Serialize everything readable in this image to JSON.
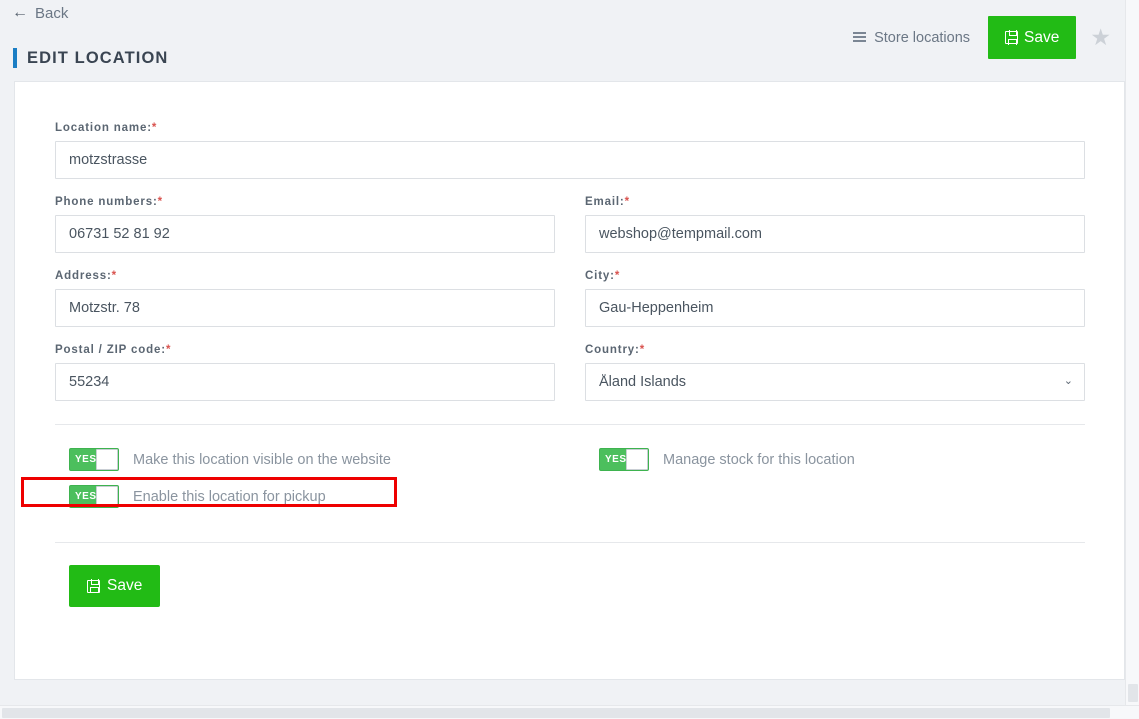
{
  "header": {
    "back_label": "Back",
    "page_title": "EDIT LOCATION",
    "store_locations_label": "Store locations",
    "save_label": "Save",
    "star_glyph": "★",
    "accent_color": "#1b7ec4",
    "save_color": "#22bb15"
  },
  "form": {
    "fields": {
      "location_name": {
        "label": "Location name:",
        "required": "*",
        "value": "motzstrasse",
        "placeholder": ""
      },
      "phone_numbers": {
        "label": "Phone numbers:",
        "required": "*",
        "value": "06731 52 81 92",
        "placeholder": ""
      },
      "email": {
        "label": "Email:",
        "required": "*",
        "value": "webshop@tempmail.com",
        "placeholder": ""
      },
      "address": {
        "label": "Address:",
        "required": "*",
        "value": "Motzstr. 78",
        "placeholder": ""
      },
      "city": {
        "label": "City:",
        "required": "*",
        "value": "Gau-Heppenheim",
        "placeholder": ""
      },
      "postal_code": {
        "label": "Postal / ZIP code:",
        "required": "*",
        "value": "55234",
        "placeholder": ""
      },
      "country": {
        "label": "Country:",
        "required": "*",
        "value": "Åland Islands",
        "caret_glyph": "⌄",
        "options": [
          "Åland Islands"
        ]
      }
    },
    "toggles": [
      {
        "label": "Make this location visible on the website",
        "state_text": "YES",
        "on": true
      },
      {
        "label": "Manage stock for this location",
        "state_text": "YES",
        "on": true
      },
      {
        "label": "Enable this location for pickup",
        "state_text": "YES",
        "on": true
      }
    ],
    "save_label": "Save"
  },
  "highlight": {
    "color": "#ee0000",
    "target": "Enable this location for pickup"
  }
}
